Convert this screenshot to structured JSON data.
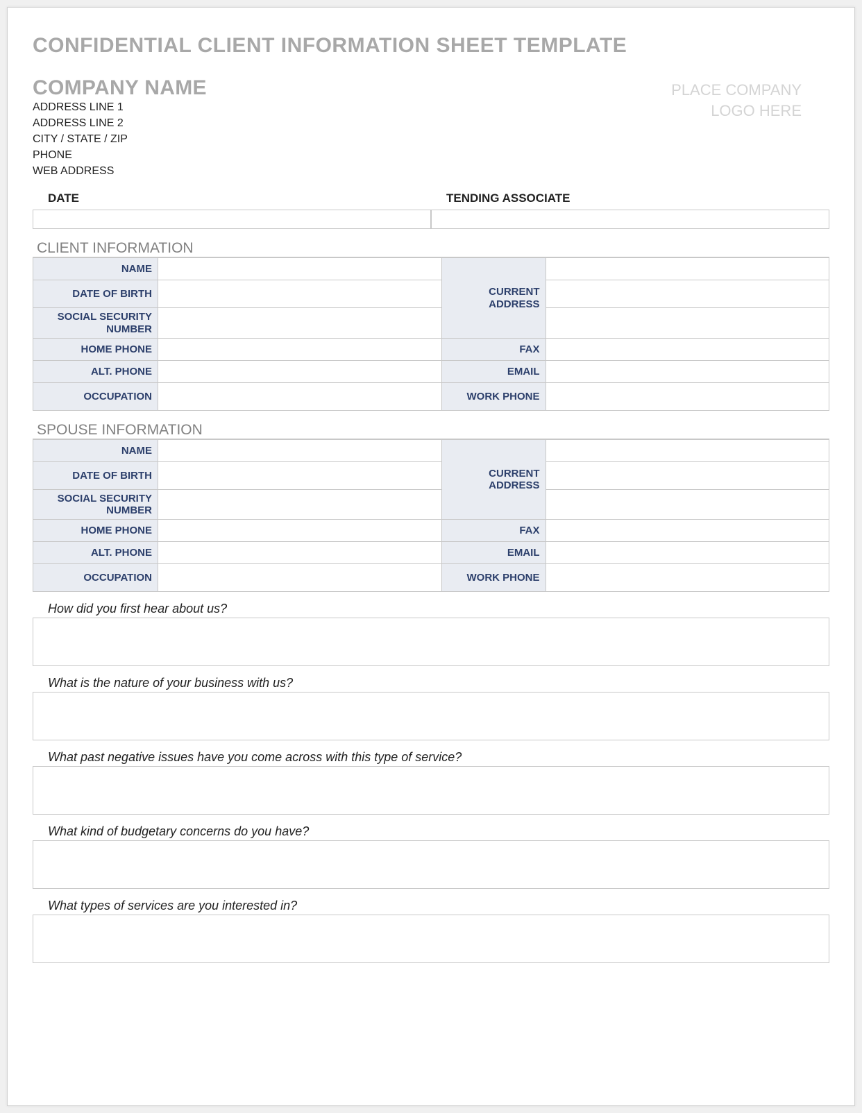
{
  "doc_title": "CONFIDENTIAL CLIENT INFORMATION SHEET TEMPLATE",
  "company": {
    "name": "COMPANY NAME",
    "addr1": "ADDRESS LINE 1",
    "addr2": "ADDRESS LINE 2",
    "csz": "CITY / STATE / ZIP",
    "phone": "PHONE",
    "web": "WEB ADDRESS"
  },
  "logo_placeholder_l1": "PLACE COMPANY",
  "logo_placeholder_l2": "LOGO HERE",
  "date_row": {
    "date_label": "DATE",
    "assoc_label": "TENDING ASSOCIATE"
  },
  "sections": {
    "client_title": "CLIENT INFORMATION",
    "spouse_title": "SPOUSE INFORMATION",
    "labels": {
      "name": "NAME",
      "dob": "DATE OF BIRTH",
      "ssn": "SOCIAL SECURITY NUMBER",
      "home_phone": "HOME PHONE",
      "alt_phone": "ALT. PHONE",
      "occupation": "OCCUPATION",
      "curr_addr": "CURRENT ADDRESS",
      "fax": "FAX",
      "email": "EMAIL",
      "work_phone": "WORK PHONE"
    }
  },
  "questions": {
    "q1": "How did you first hear about us?",
    "q2": "What is the nature of your business with us?",
    "q3": "What past negative issues have you come across with this type of service?",
    "q4": "What kind of budgetary concerns do you have?",
    "q5": "What types of services are you interested in?"
  }
}
